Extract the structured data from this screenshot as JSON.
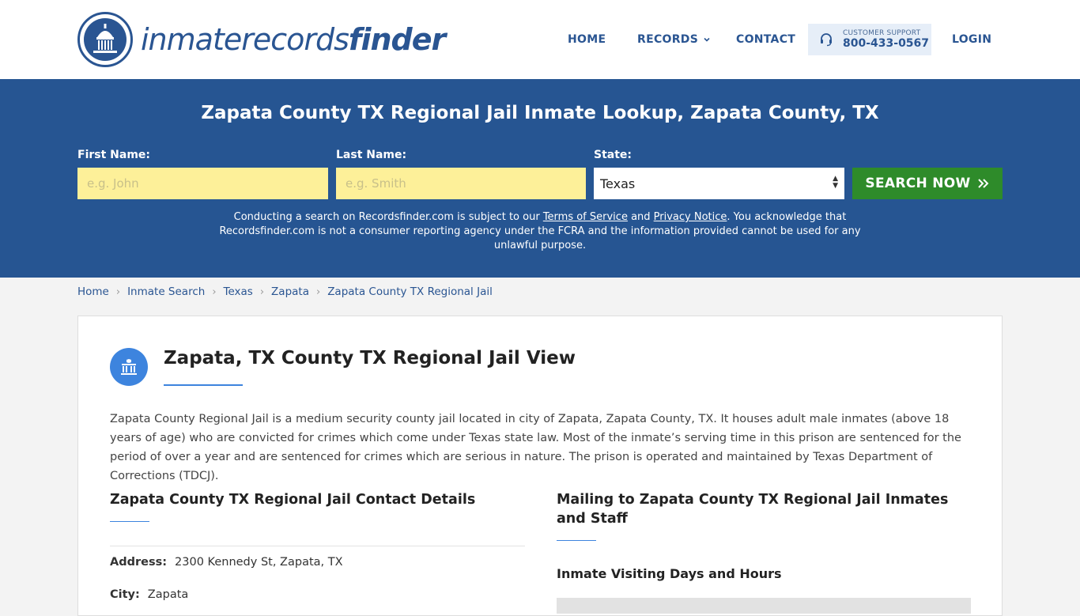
{
  "header": {
    "logo_text_light": "inmaterecords",
    "logo_text_bold": "finder",
    "nav": {
      "home": "HOME",
      "records": "RECORDS",
      "contact": "CONTACT",
      "login": "LOGIN"
    },
    "support": {
      "label": "CUSTOMER SUPPORT",
      "phone": "800-433-0567"
    }
  },
  "hero": {
    "title": "Zapata County TX Regional Jail Inmate Lookup, Zapata County, TX",
    "first_name_label": "First Name:",
    "first_name_placeholder": "e.g. John",
    "last_name_label": "Last Name:",
    "last_name_placeholder": "e.g. Smith",
    "state_label": "State:",
    "state_value": "Texas",
    "search_button": "SEARCH NOW",
    "disclaimer_pre": "Conducting a search on Recordsfinder.com is subject to our ",
    "terms_link": "Terms of Service",
    "disclaimer_and": " and ",
    "privacy_link": "Privacy Notice",
    "disclaimer_post": ". You acknowledge that Recordsfinder.com is not a consumer reporting agency under the FCRA and the information provided cannot be used for any unlawful purpose."
  },
  "breadcrumb": [
    "Home",
    "Inmate Search",
    "Texas",
    "Zapata",
    "Zapata County TX Regional Jail"
  ],
  "main": {
    "title": "Zapata, TX County TX Regional Jail View",
    "description": "Zapata County Regional Jail is a medium security county jail located in city of Zapata, Zapata County, TX. It houses adult male inmates (above 18 years of age) who are convicted for crimes which come under Texas state law. Most of the inmate’s serving time in this prison are sentenced for the period of over a year and are sentenced for crimes which are serious in nature. The prison is operated and maintained by Texas Department of Corrections (TDCJ).",
    "contact_title": "Zapata County TX Regional Jail Contact Details",
    "address_label": "Address:",
    "address_value": "2300 Kennedy St, Zapata, TX",
    "city_label": "City:",
    "city_value": "Zapata",
    "mailing_title": "Mailing to Zapata County TX Regional Jail Inmates and Staff",
    "visiting_title": "Inmate Visiting Days and Hours"
  },
  "colors": {
    "brand_blue": "#265592",
    "accent_blue": "#3d84de",
    "search_green": "#2e8b2a",
    "input_yellow": "#fdf099"
  }
}
